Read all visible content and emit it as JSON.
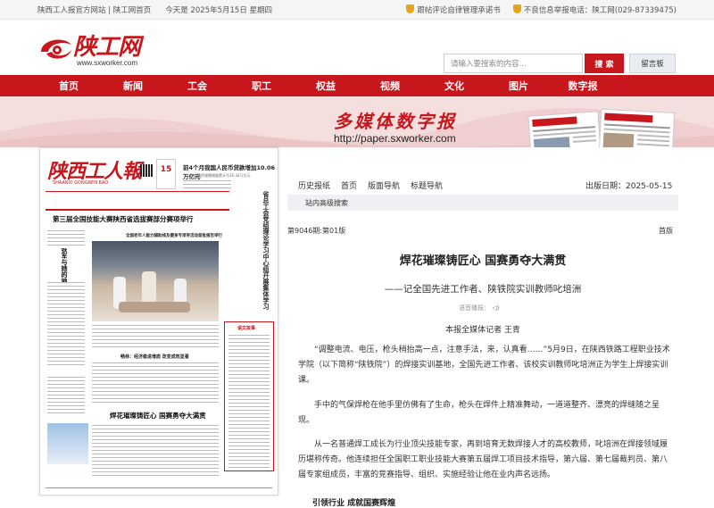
{
  "topbar": {
    "site_links": "陕西工人报官方网站 | 陕工网首页",
    "date": "今天是 2025年5月15日 星期四",
    "link_comment": "跟帖评论自律管理承诺书",
    "link_report": "不良信息举报电话：陕工网(029-87339475)"
  },
  "header": {
    "logo_text": "陕工网",
    "logo_url": "www.sxworker.com",
    "search_placeholder": "请输入要搜索的内容...",
    "search_button": "搜 索",
    "guestbook_button": "留言板"
  },
  "nav": {
    "items": [
      "首页",
      "新闻",
      "工会",
      "职工",
      "权益",
      "视频",
      "文化",
      "图片",
      "数字报"
    ]
  },
  "banner": {
    "title": "多媒体数字报",
    "url": "http://paper.sxworker.com"
  },
  "newspaper": {
    "masthead": "陕西工人報",
    "masthead_sub": "SHAANXI GONGREN BAO",
    "day": "15",
    "top_headline": "前4个月我国人民币贷款增加10.06万亿元",
    "top_sub": "社会融资规模增量累计为16.34万亿元",
    "main_headline": "第三届全国技能大赛陕西省选拔赛部分赛项举行",
    "vertical_headline": "省总工会党组理论学习中心组开展集体学习",
    "side_headline": "铁军与她的地方",
    "small_headline": "全国老年人能力辅助线及健身专项导活动首批报告举行",
    "feature_headline": "焊花璀璨铸匠心 国赛勇夺大满贯",
    "mid_headline": "畅林：经济稳进增质 改变成效显著",
    "box_title": "语文故事"
  },
  "tools": {
    "items": [
      "历史报纸",
      "首页",
      "版面导航",
      "标题导航"
    ],
    "pub_date": "出版日期：2025-05-15"
  },
  "advanced_search": "站内高级搜索",
  "page_info": "第9046期:第01版",
  "page_name": "首版",
  "article": {
    "title": "焊花璀璨铸匠心 国赛勇夺大满贯",
    "subtitle": "——记全国先进工作者、陕铁院实训教师叱培洲",
    "audio_label": "语音播报：",
    "author": "本报全媒体记者 王青",
    "paragraphs": [
      "“调整电流、电压，枪头稍抬高一点，注意手法，来，认真看……”5月9日，在陕西铁路工程职业技术学院（以下简称“陕铁院”）的焊接实训基地，全国先进工作者、该校实训教师叱培洲正为学生上焊接实训课。",
      "手中的气保焊枪在他手里仿佛有了生命，枪头在焊件上精准舞动，一道道整齐、漂亮的焊缝随之呈现。",
      "从一名普通焊工成长为行业顶尖技能专家，再到培育无数焊接人才的高校教师，叱培洲在焊接领域履历堪称传奇。他连续担任全国职工职业技能大赛第五届焊工项目技术指导，第六届、第七届裁判员、第八届专家组成员，丰富的竞赛指导、组织、实施经验让他在业内声名远扬。"
    ],
    "section_heading": "引领行业 成就国赛辉煌"
  },
  "colors": {
    "brand_red": "#c8161d",
    "banner_pink": "#f4dede"
  }
}
